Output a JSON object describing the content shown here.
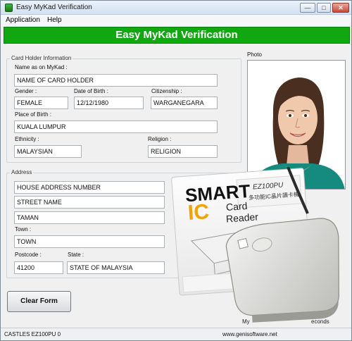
{
  "window": {
    "title": "Easy MyKad Verification"
  },
  "menu": {
    "application": "Application",
    "help": "Help"
  },
  "banner": {
    "title": "Easy MyKad Verification"
  },
  "card_holder": {
    "group_title": "Card Holder Information",
    "name_label": "Name as on MyKad :",
    "name_value": "NAME OF CARD HOLDER",
    "gender_label": "Gender :",
    "gender_value": "FEMALE",
    "dob_label": "Date of Birth :",
    "dob_value": "12/12/1980",
    "citizenship_label": "Citizenship :",
    "citizenship_value": "WARGANEGARA",
    "pob_label": "Place of Birth :",
    "pob_value": "KUALA LUMPUR",
    "ethnicity_label": "Ethnicity :",
    "ethnicity_value": "MALAYSIAN",
    "religion_label": "Religion :",
    "religion_value": "RELIGION"
  },
  "photo": {
    "label": "Photo"
  },
  "address": {
    "group_title": "Address",
    "line1": "HOUSE ADDRESS NUMBER",
    "line2": "STREET NAME",
    "line3": "TAMAN",
    "town_label": "Town :",
    "town_value": "TOWN",
    "postcode_label": "Postcode :",
    "postcode_value": "41200",
    "state_label": "State :",
    "state_value": "STATE OF MALAYSIA"
  },
  "buttons": {
    "clear_form": "Clear Form"
  },
  "partial_text": {
    "left": "My",
    "right": "econds"
  },
  "product_box": {
    "brand_line1": "SMART",
    "brand_ic": "IC",
    "brand_line2": "Card",
    "brand_line3": "Reader",
    "model": "EZ100PU",
    "chinese": "多功能IC晶片讀卡機"
  },
  "status": {
    "device": "CASTLES EZ100PU 0",
    "website": "www.genisoftware.net"
  },
  "colors": {
    "banner": "#11a711",
    "window_bg": "#f0f0f0"
  }
}
